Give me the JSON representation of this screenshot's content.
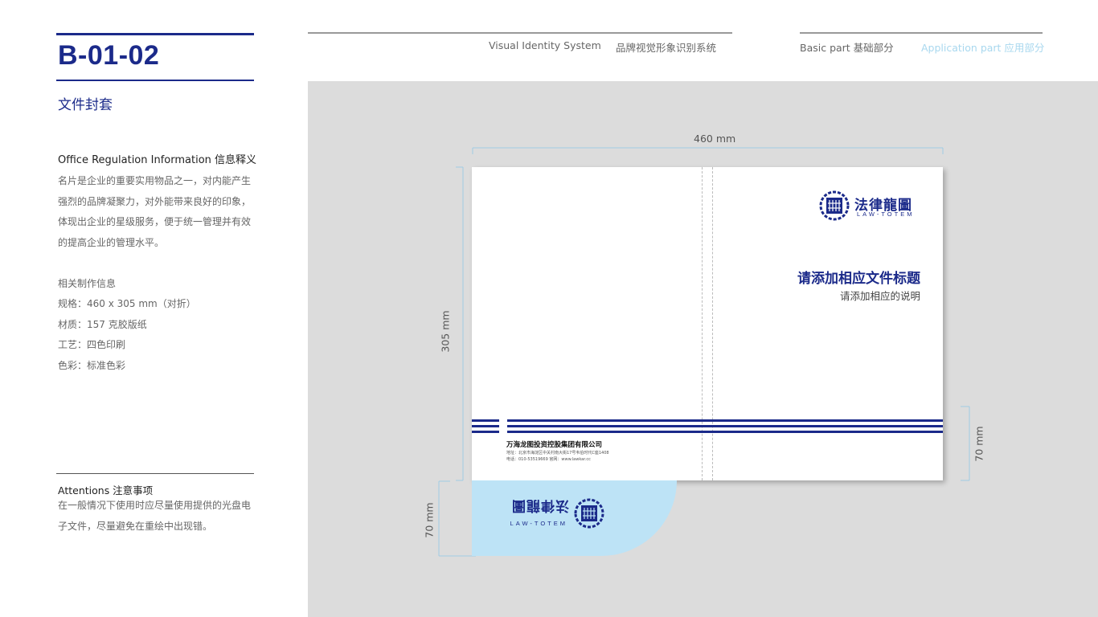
{
  "left": {
    "code": "B-01-02",
    "subtitle": "文件封套",
    "info_heading": "Office Regulation Information  信息释义",
    "description": "名片是企业的重要实用物品之一，对内能产生强烈的品牌凝聚力，对外能带来良好的印象，体现出企业的星级服务，便于统一管理并有效的提高企业的管理水平。",
    "specs": [
      "相关制作信息",
      "规格：460  x 305 mm（对折）",
      "材质：157 克胶版纸",
      "工艺：四色印刷",
      "色彩：标准色彩"
    ],
    "attention_heading": "Attentions 注意事项",
    "attention_text": "在一般情况下使用时应尽量使用提供的光盘电子文件，尽量避免在重绘中出现错。"
  },
  "header": {
    "vis_en": "Visual Identity System",
    "vis_cn": "品牌视觉形象识别系统",
    "basic": "Basic part  基础部分",
    "application": "Application part  应用部分"
  },
  "diagram": {
    "width_label": "460 mm",
    "height_label": "305 mm",
    "flap_label": "70 mm",
    "right_label": "70 mm"
  },
  "cover": {
    "logo_cn": "法律龍圖",
    "logo_en": "LAW-TOTEM",
    "doc_title": "请添加相应文件标题",
    "doc_subtitle": "请添加相应的说明",
    "company": "万海龙图投资控股集团有限公司",
    "address": "地址：北京市海淀区中关村南大街17号韦伯时代C座1408",
    "contact": "电话：010-53519669     官网：www.lawkar.cc"
  },
  "colors": {
    "brand_blue": "#1b2a8a",
    "light_blue": "#bde3f6",
    "active_nav": "#a9d8ef",
    "canvas_gray": "#dcdcdc",
    "dimension_line": "#9fcbe3"
  }
}
